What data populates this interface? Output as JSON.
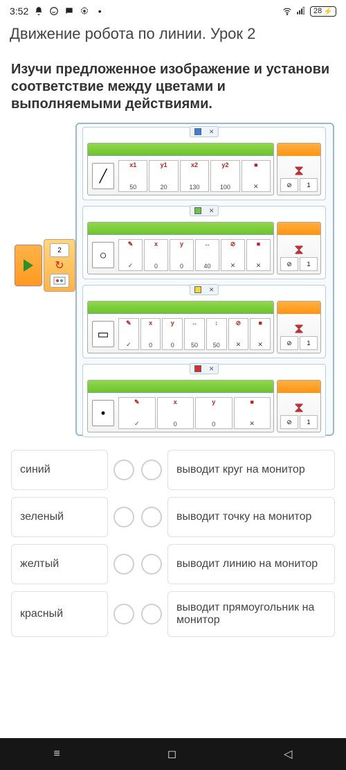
{
  "status": {
    "time": "3:52",
    "icons_left": [
      "bell",
      "whatsapp",
      "chat",
      "gear",
      "dot"
    ],
    "icons_right": [
      "wifi",
      "signal"
    ],
    "battery": "28",
    "charging": true
  },
  "title": "Движение робота по линии. Урок 2",
  "task": "Изучи предложенное изображение и установи соответствие между цветами и выполняемыми действиями.",
  "diagram": {
    "loop_count": "2",
    "cases": [
      {
        "color": "#3a7fe0",
        "shape_glyph": "╱",
        "params": [
          {
            "lbl": "x1",
            "val": "50"
          },
          {
            "lbl": "y1",
            "val": "20"
          },
          {
            "lbl": "x2",
            "val": "130"
          },
          {
            "lbl": "y2",
            "val": "100"
          },
          {
            "lbl": "■",
            "val": "✕"
          }
        ],
        "wait": "1"
      },
      {
        "color": "#6cc24a",
        "shape_glyph": "○",
        "params": [
          {
            "lbl": "✎",
            "val": "✓"
          },
          {
            "lbl": "x",
            "val": "0"
          },
          {
            "lbl": "y",
            "val": "0"
          },
          {
            "lbl": "↔",
            "val": "40"
          },
          {
            "lbl": "⊘",
            "val": "✕"
          },
          {
            "lbl": "■",
            "val": "✕"
          }
        ],
        "wait": "1"
      },
      {
        "color": "#f0d838",
        "shape_glyph": "▭",
        "params": [
          {
            "lbl": "✎",
            "val": "✓"
          },
          {
            "lbl": "x",
            "val": "0"
          },
          {
            "lbl": "y",
            "val": "0"
          },
          {
            "lbl": "↔",
            "val": "50"
          },
          {
            "lbl": "↕",
            "val": "50"
          },
          {
            "lbl": "⊘",
            "val": "✕"
          },
          {
            "lbl": "■",
            "val": "✕"
          }
        ],
        "wait": "1"
      },
      {
        "color": "#d43030",
        "shape_glyph": "•",
        "params": [
          {
            "lbl": "✎",
            "val": "✓"
          },
          {
            "lbl": "x",
            "val": "0"
          },
          {
            "lbl": "y",
            "val": "0"
          },
          {
            "lbl": "■",
            "val": "✕"
          }
        ],
        "wait": "1"
      }
    ]
  },
  "match": {
    "left": [
      "синий",
      "зеленый",
      "желтый",
      "красный"
    ],
    "right": [
      "выводит круг на монитор",
      "выводит точку на монитор",
      "выводит линию на монитор",
      "выводит прямоугольник на монитор"
    ]
  },
  "nav": {
    "recent": "≡",
    "home": "◻",
    "back": "◁"
  }
}
